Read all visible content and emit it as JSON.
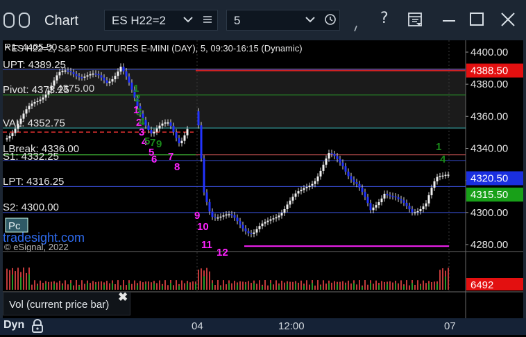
{
  "window": {
    "title": "Chart",
    "symbol": "ES H22=2",
    "interval": "5"
  },
  "chart": {
    "header": "* ES H22=2, S&P 500 FUTURES E-MINI (DAY), 5, 09:30-16:15 (Dynamic)",
    "truncated_r1": "R1: 4405.50",
    "levels": [
      {
        "label": "UPT: 4389.25",
        "price": 4389.25,
        "color": "#3a4fd8"
      },
      {
        "label": "Pivot: 4373.25",
        "price": 4373.25,
        "color": "#2aa02a"
      },
      {
        "label": "VAL: 4352.75",
        "price": 4352.75,
        "color": "#2aa8a8"
      },
      {
        "label": "LBreak: 4336.00",
        "price": 4336.0,
        "color": "#c05050"
      },
      {
        "label": "S1: 4332.25",
        "price": 4332.25,
        "color": "#3a4fd8"
      },
      {
        "label": "LPT: 4316.25",
        "price": 4316.25,
        "color": "#3a4fd8"
      },
      {
        "label": "S2: 4300.00",
        "price": 4300.0,
        "color": "#3a4fd8"
      }
    ],
    "overlay_fragments": [
      "4375.00"
    ],
    "pc_label": "Pc",
    "brand_link": "tradesight.com",
    "copyright": "© eSignal, 2022",
    "price_axis": [
      "4400.00",
      "4380.00",
      "4360.00",
      "4340.00",
      "4320.00",
      "4300.00",
      "4280.00"
    ],
    "price_markers": [
      {
        "value": "4388.50",
        "color": "#e31010"
      },
      {
        "value": "4320.50",
        "color": "#1a2fe0"
      },
      {
        "value": "4315.50",
        "color": "#18a018"
      }
    ],
    "volume_marker": {
      "value": "6492",
      "color": "#e31010"
    },
    "volume_panel_label": "Vol (current price bar)",
    "time_labels": [
      "04",
      "12:00",
      "07"
    ],
    "status_mode": "Dyn",
    "counts": [
      {
        "text": "1",
        "color": "#ff22ff"
      },
      {
        "text": "2",
        "color": "#ff22ff"
      },
      {
        "text": "3",
        "color": "#ff22ff"
      },
      {
        "text": "4",
        "color": "#ff22ff"
      },
      {
        "text": "5",
        "color": "#ff22ff"
      },
      {
        "text": "6",
        "color": "#ff22ff"
      },
      {
        "text": "7",
        "color": "#ff22ff"
      },
      {
        "text": "8",
        "color": "#ff22ff"
      },
      {
        "text": "9",
        "color": "#ff22ff"
      },
      {
        "text": "10",
        "color": "#ff22ff"
      },
      {
        "text": "11",
        "color": "#ff22ff"
      },
      {
        "text": "12",
        "color": "#ff22ff"
      },
      {
        "text": "1",
        "color": "#1a8a1a"
      },
      {
        "text": "2",
        "color": "#1a8a1a"
      },
      {
        "text": "3",
        "color": "#1a8a1a"
      },
      {
        "text": "4",
        "color": "#1a8a1a"
      },
      {
        "text": "5",
        "color": "#1a8a1a"
      },
      {
        "text": "7",
        "color": "#1a8a1a"
      },
      {
        "text": "9",
        "color": "#1a8a1a"
      },
      {
        "text": "1",
        "color": "#1a8a1a"
      },
      {
        "text": "4",
        "color": "#1a8a1a"
      }
    ]
  },
  "icons": [
    "chart-icon",
    "chevron-down-icon",
    "menu-icon",
    "clock-icon",
    "pin-icon",
    "help-icon",
    "layout-icon",
    "minimize-icon",
    "maximize-icon",
    "close-icon",
    "lock-icon"
  ]
}
